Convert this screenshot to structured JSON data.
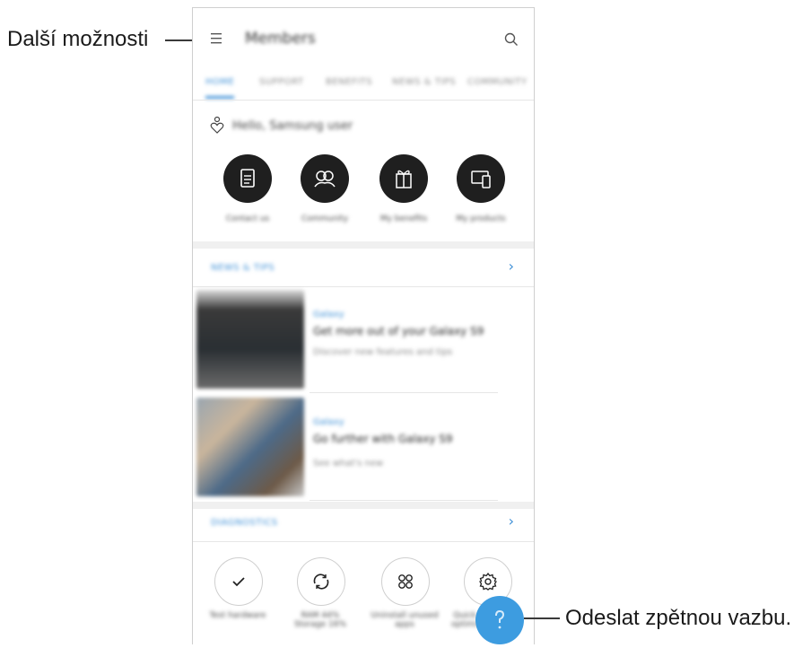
{
  "callouts": {
    "more_options": "Další možnosti",
    "send_feedback": "Odeslat zpětnou vazbu."
  },
  "app": {
    "title": "Members",
    "tabs": [
      "HOME",
      "SUPPORT",
      "BENEFITS",
      "NEWS & TIPS",
      "COMMUNITY"
    ],
    "greeting": "Hello, Samsung user",
    "shortcuts": [
      {
        "label": "Contact us",
        "icon": "document-icon"
      },
      {
        "label": "Community",
        "icon": "community-icon"
      },
      {
        "label": "My benefits",
        "icon": "gift-icon"
      },
      {
        "label": "My products",
        "icon": "devices-icon"
      }
    ],
    "news_section": "NEWS & TIPS",
    "news": [
      {
        "tag": "Galaxy",
        "title": "Get more out of your Galaxy S9",
        "desc": "Discover new features and tips"
      },
      {
        "tag": "Galaxy",
        "title": "Go further with Galaxy S9",
        "desc": "See what's new"
      }
    ],
    "diagnostics_section": "DIAGNOSTICS",
    "diagnostics": [
      {
        "label": "Test hardware",
        "icon": "check-icon"
      },
      {
        "label": "RAM 44% Storage 16%",
        "icon": "refresh-icon"
      },
      {
        "label": "Uninstall unused apps",
        "icon": "apps-grid-icon"
      },
      {
        "label": "Quick optimization",
        "icon": "gear-icon"
      }
    ]
  },
  "colors": {
    "accent": "#3d8fd6",
    "fab": "#3d9ce0",
    "dark_circle": "#1f1f1f"
  }
}
